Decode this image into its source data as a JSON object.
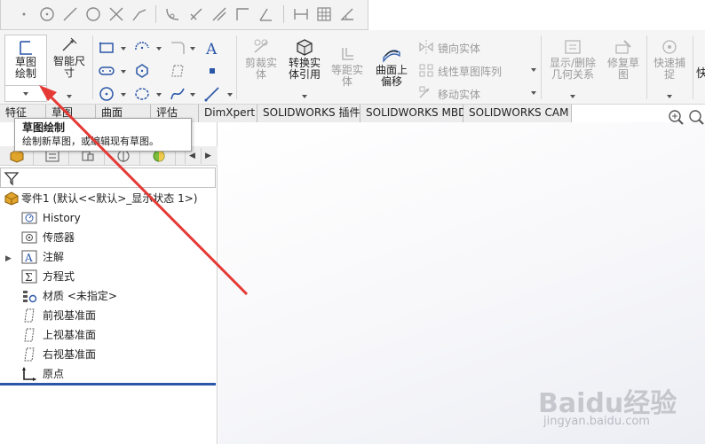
{
  "ribbon": {
    "sketch": {
      "label": "草图绘制"
    },
    "smart_dimension": {
      "label": "智能尺寸"
    },
    "trim_entities": {
      "label": "剪裁实体"
    },
    "convert_entities": {
      "label": "转换实体引用"
    },
    "offset_entities": {
      "label": "等距实体"
    },
    "offset_on_surface": {
      "label": "曲面上偏移"
    },
    "mirror_entities": {
      "label": "镜向实体"
    },
    "linear_pattern": {
      "label": "线性草图阵列"
    },
    "move_entities": {
      "label": "移动实体"
    },
    "display_delete_relations": {
      "label": "显示/删除几何关系"
    },
    "repair_sketch": {
      "label": "修复草图"
    },
    "rapid_snaps": {
      "label": "快速捕捉"
    },
    "overflow": {
      "label": "快"
    }
  },
  "tabs": [
    "特征",
    "草图",
    "曲面",
    "评估",
    "DimXpert",
    "SOLIDWORKS 插件",
    "SOLIDWORKS MBD",
    "SOLIDWORKS CAM"
  ],
  "tooltip": {
    "title": "草图绘制",
    "description": "绘制新草图，或编辑现有草图。"
  },
  "tree": {
    "part": "零件1 (默认<<默认>_显示状态 1>)",
    "items": [
      "History",
      "传感器",
      "注解",
      "方程式",
      "材质 <未指定>",
      "前视基准面",
      "上视基准面",
      "右视基准面",
      "原点"
    ]
  },
  "watermark": {
    "brand": "Baidu经验",
    "url": "jingyan.baidu.com"
  },
  "colors": {
    "accent": "#2b57a8",
    "arrow": "#e53935",
    "part_icon": "#e2a52b"
  }
}
